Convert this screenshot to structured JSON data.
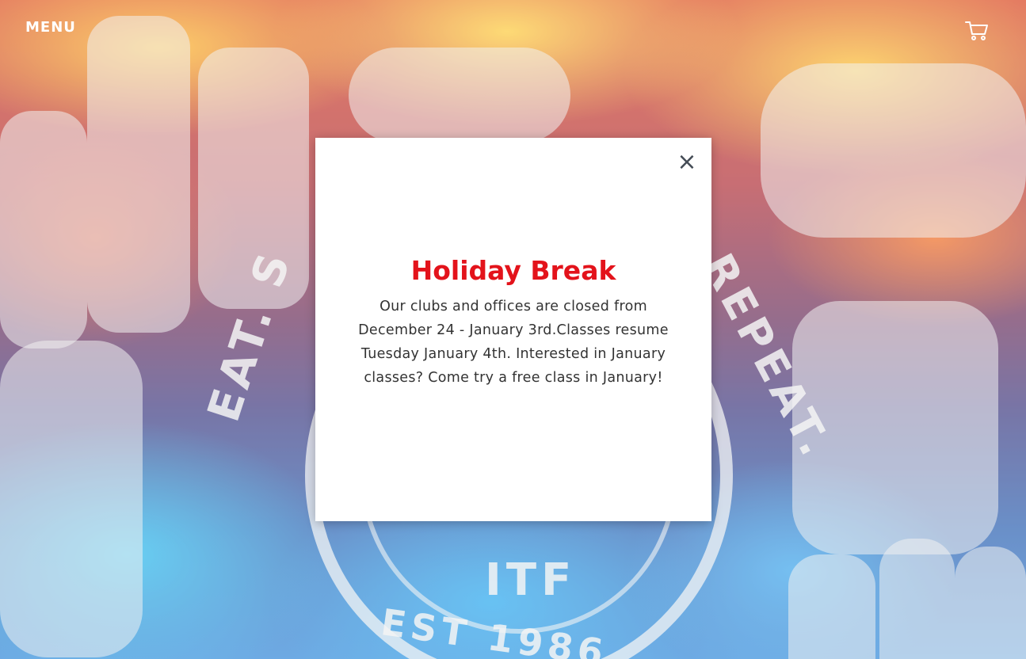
{
  "header": {
    "menu_label": "MENU",
    "cart_icon": "shopping-cart-icon"
  },
  "hero": {
    "emblem_left_text": "EAT. S",
    "emblem_right_text": "REPEAT.",
    "emblem_center_text": "ITF",
    "emblem_bottom_text": "EST 1986"
  },
  "modal": {
    "close_icon": "close-icon",
    "close_glyph": "×",
    "title": "Holiday Break",
    "body": "Our clubs and offices are closed from December 24 - January 3rd.Classes resume Tuesday January 4th. Interested in January classes? Come try a free class in January!",
    "title_color": "#e3131b"
  }
}
